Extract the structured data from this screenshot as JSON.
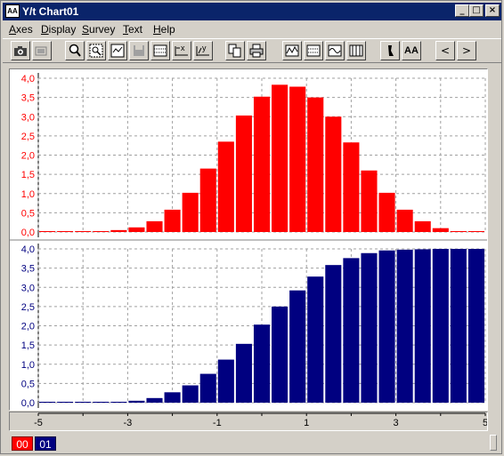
{
  "window": {
    "title": "Y/t Chart01",
    "icon_text": "AA",
    "controls": {
      "minimize": "_",
      "maximize": "□",
      "close": "×"
    }
  },
  "menu": {
    "axes": "A",
    "axes_rest": "xes",
    "display": "D",
    "display_rest": "isplay",
    "survey": "S",
    "survey_rest": "urvey",
    "text": "T",
    "text_rest": "ext",
    "help": "H",
    "help_rest": "elp"
  },
  "toolbar_icons": [
    "camera-icon",
    "camera-disabled-icon",
    "zoom-icon",
    "zoom-area-icon",
    "zoom-fit-icon",
    "disk-icon",
    "grid-icon",
    "x-scale-icon",
    "y-scale-icon",
    "copy-icon",
    "print-icon",
    "chart-a-icon",
    "chart-b-icon",
    "chart-c-icon",
    "chart-d-icon",
    "cursor-icon",
    "font-size-icon",
    "prev-icon",
    "next-icon"
  ],
  "toolbar_text": {
    "font_size": "AA",
    "prev": "<",
    "next": ">"
  },
  "colors": {
    "top_series": "#ff0000",
    "bottom_series": "#000080",
    "grid": "#a0a0a0"
  },
  "status": {
    "channel_0": "00",
    "channel_1": "01"
  },
  "chart_data": [
    {
      "type": "bar",
      "ylim": [
        0,
        4.0
      ],
      "yticks": [
        "0,0",
        "0,5",
        "1,0",
        "1,5",
        "2,0",
        "2,5",
        "3,0",
        "3,5",
        "4,0"
      ],
      "xlim": [
        -5,
        5
      ],
      "xticks": [
        "-5",
        "-3",
        "-1",
        "1",
        "3",
        "5"
      ],
      "grid": true,
      "color": "#ff0000",
      "x": [
        -4.8,
        -4.4,
        -4.0,
        -3.6,
        -3.2,
        -2.8,
        -2.4,
        -2.0,
        -1.6,
        -1.2,
        -0.8,
        -0.4,
        0.0,
        0.4,
        0.8,
        1.2,
        1.6,
        2.0,
        2.4,
        2.8,
        3.2,
        3.6,
        4.0,
        4.4,
        4.8
      ],
      "values": [
        0.0,
        0.0,
        0.0,
        0.0,
        0.05,
        0.12,
        0.28,
        0.58,
        1.02,
        1.65,
        2.35,
        3.03,
        3.52,
        3.83,
        3.78,
        3.5,
        3.0,
        2.33,
        1.6,
        1.02,
        0.58,
        0.28,
        0.1,
        0.02,
        0.0
      ]
    },
    {
      "type": "bar",
      "ylim": [
        0,
        4.0
      ],
      "yticks": [
        "0,0",
        "0,5",
        "1,0",
        "1,5",
        "2,0",
        "2,5",
        "3,0",
        "3,5",
        "4,0"
      ],
      "xlim": [
        -5,
        5
      ],
      "xticks": [
        "-5",
        "-3",
        "-1",
        "1",
        "3",
        "5"
      ],
      "grid": true,
      "color": "#000080",
      "x": [
        -4.8,
        -4.4,
        -4.0,
        -3.6,
        -3.2,
        -2.8,
        -2.4,
        -2.0,
        -1.6,
        -1.2,
        -0.8,
        -0.4,
        0.0,
        0.4,
        0.8,
        1.2,
        1.6,
        2.0,
        2.4,
        2.8,
        3.2,
        3.6,
        4.0,
        4.4,
        4.8
      ],
      "values": [
        0.0,
        0.0,
        0.0,
        0.0,
        0.02,
        0.05,
        0.12,
        0.27,
        0.45,
        0.75,
        1.12,
        1.53,
        2.03,
        2.5,
        2.92,
        3.28,
        3.58,
        3.76,
        3.89,
        3.96,
        3.98,
        3.99,
        4.0,
        4.0,
        4.0
      ]
    }
  ]
}
